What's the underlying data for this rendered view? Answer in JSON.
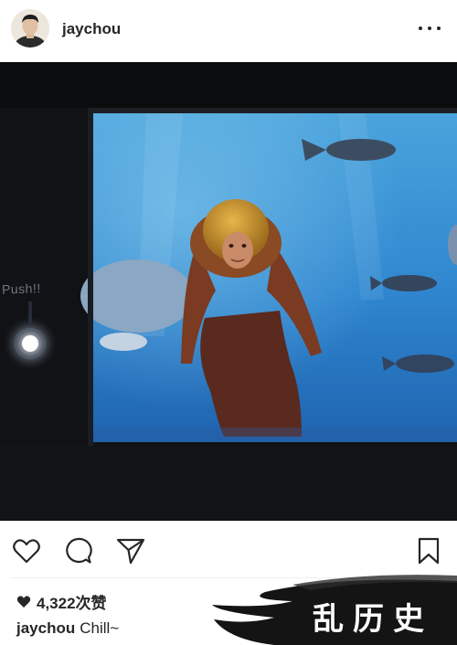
{
  "header": {
    "username": "jaychou",
    "avatar_icon": "profile-avatar",
    "more_icon": "more-options-icon"
  },
  "photo": {
    "push_label": "Push!!",
    "colors": {
      "screen_water": "#2f86cf",
      "dark_frame": "#0f1114",
      "diver_gold": "#c8962a"
    }
  },
  "actions": {
    "like_icon": "heart-outline-icon",
    "comment_icon": "comment-bubble-icon",
    "share_icon": "paper-plane-icon",
    "save_icon": "bookmark-icon"
  },
  "post": {
    "likes": "4,322次赞",
    "caption_user": "jaychou",
    "caption_text": "Chill~"
  },
  "watermark": {
    "text": "乱历史"
  }
}
